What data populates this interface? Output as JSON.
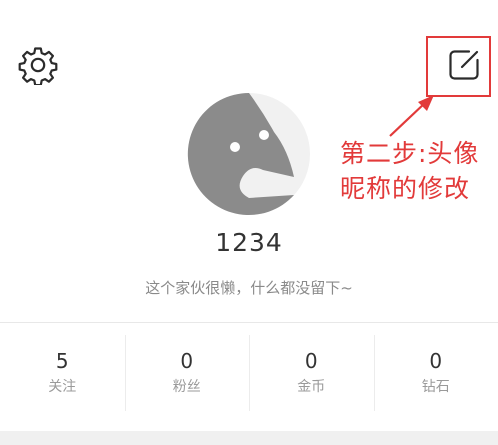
{
  "header": {
    "settings_icon": "gear-icon",
    "edit_icon": "edit-square-icon"
  },
  "annotation": {
    "line1": "第二步:头像",
    "line2": "昵称的修改",
    "color": "#e23a3a"
  },
  "profile": {
    "avatar_icon": "default-avatar-face-icon",
    "username": "1234",
    "bio": "这个家伙很懒，什么都没留下~"
  },
  "stats": [
    {
      "value": "5",
      "label": "关注"
    },
    {
      "value": "0",
      "label": "粉丝"
    },
    {
      "value": "0",
      "label": "金币"
    },
    {
      "value": "0",
      "label": "钻石"
    }
  ]
}
